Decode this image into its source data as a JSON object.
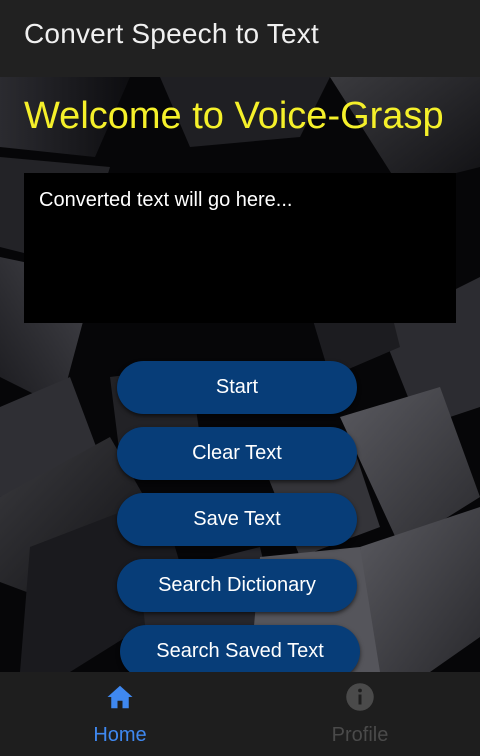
{
  "appbar": {
    "title": "Convert Speech to Text"
  },
  "main": {
    "welcome": "Welcome to Voice-Grasp",
    "output_placeholder": "Converted text will go here...",
    "buttons": [
      {
        "label": "Start"
      },
      {
        "label": "Clear Text"
      },
      {
        "label": "Save Text"
      },
      {
        "label": "Search Dictionary"
      },
      {
        "label": "Search Saved Text"
      }
    ]
  },
  "bottom_nav": {
    "items": [
      {
        "label": "Home",
        "icon": "home-icon",
        "active": true
      },
      {
        "label": "Profile",
        "icon": "info-icon",
        "active": false
      }
    ]
  },
  "colors": {
    "appbar": "#212121",
    "title_text": "#f0f0f0",
    "welcome_text": "#f5f02a",
    "button": "#073d78",
    "nav_active": "#3f88f0",
    "nav_inactive": "#4a4a4a"
  }
}
